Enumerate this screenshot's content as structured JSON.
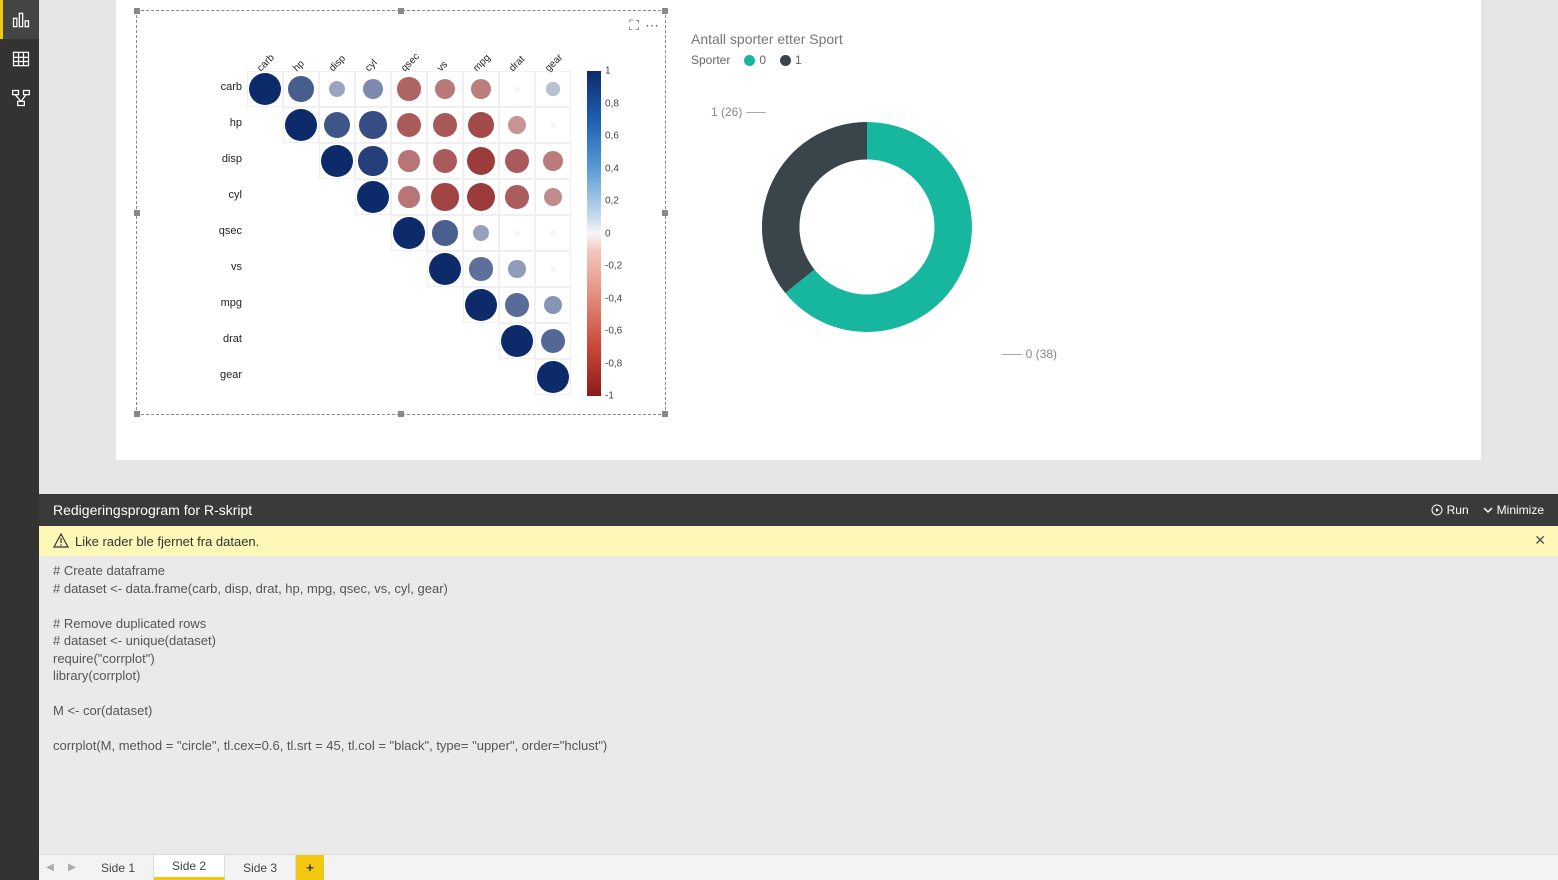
{
  "side_rail": {
    "report_tooltip": "Report",
    "data_tooltip": "Data",
    "model_tooltip": "Model"
  },
  "corrplot_visual": {
    "row_labels": [
      "carb",
      "hp",
      "disp",
      "cyl",
      "qsec",
      "vs",
      "mpg",
      "drat",
      "gear"
    ],
    "diag_labels": [
      "carb",
      "hp",
      "disp",
      "cyl",
      "qsec",
      "vs",
      "mpg",
      "drat",
      "gear"
    ],
    "colorbar_ticks": [
      "1",
      "0,8",
      "0,6",
      "0,4",
      "0,2",
      "0",
      "-0,2",
      "-0,4",
      "-0,6",
      "-0,8",
      "-1"
    ]
  },
  "donut": {
    "title": "Antall sporter etter Sport",
    "legend_label": "Sporter",
    "items": [
      {
        "name": "0",
        "value": 38,
        "color": "#16b79e"
      },
      {
        "name": "1",
        "value": 26,
        "color": "#39454b"
      }
    ],
    "data_label_0": "0 (38)",
    "data_label_1": "1 (26)"
  },
  "editor": {
    "title": "Redigeringsprogram for R-skript",
    "run_label": "Run",
    "minimize_label": "Minimize",
    "warning_text": "Like rader ble fjernet fra dataen.",
    "code": "# Create dataframe\n# dataset <- data.frame(carb, disp, drat, hp, mpg, qsec, vs, cyl, gear)\n\n# Remove duplicated rows\n# dataset <- unique(dataset)\nrequire(\"corrplot\")\nlibrary(corrplot)\n\nM <- cor(dataset)\n\ncorrplot(M, method = \"circle\", tl.cex=0.6, tl.srt = 45, tl.col = \"black\", type= \"upper\", order=\"hclust\")"
  },
  "tabs": {
    "items": [
      "Side 1",
      "Side 2",
      "Side 3"
    ],
    "active_index": 1
  },
  "chart_data": [
    {
      "type": "heatmap",
      "title": "",
      "labels": [
        "carb",
        "hp",
        "disp",
        "cyl",
        "qsec",
        "vs",
        "mpg",
        "drat",
        "gear"
      ],
      "matrix_upper": [
        [
          1.0,
          0.75,
          0.4,
          0.53,
          -0.66,
          -0.57,
          -0.55,
          0.0,
          0.27
        ],
        [
          null,
          1.0,
          0.79,
          0.83,
          -0.71,
          -0.72,
          -0.78,
          -0.45,
          0.0
        ],
        [
          null,
          null,
          1.0,
          0.9,
          -0.59,
          -0.71,
          -0.85,
          -0.71,
          -0.56
        ],
        [
          null,
          null,
          null,
          1.0,
          -0.59,
          -0.81,
          -0.85,
          -0.7,
          -0.49
        ],
        [
          null,
          null,
          null,
          null,
          1.0,
          0.74,
          0.42,
          0.0,
          0.0
        ],
        [
          null,
          null,
          null,
          null,
          null,
          1.0,
          0.66,
          0.44,
          0.0
        ],
        [
          null,
          null,
          null,
          null,
          null,
          null,
          1.0,
          0.68,
          0.48
        ],
        [
          null,
          null,
          null,
          null,
          null,
          null,
          null,
          1.0,
          0.7
        ],
        [
          null,
          null,
          null,
          null,
          null,
          null,
          null,
          null,
          1.0
        ]
      ],
      "color_scale": {
        "min": -1,
        "max": 1
      }
    },
    {
      "type": "pie",
      "title": "Antall sporter etter Sport",
      "series": [
        {
          "name": "Sporter",
          "values": [
            38,
            26
          ]
        }
      ],
      "categories": [
        "0",
        "1"
      ],
      "colors": [
        "#16b79e",
        "#39454b"
      ]
    }
  ]
}
